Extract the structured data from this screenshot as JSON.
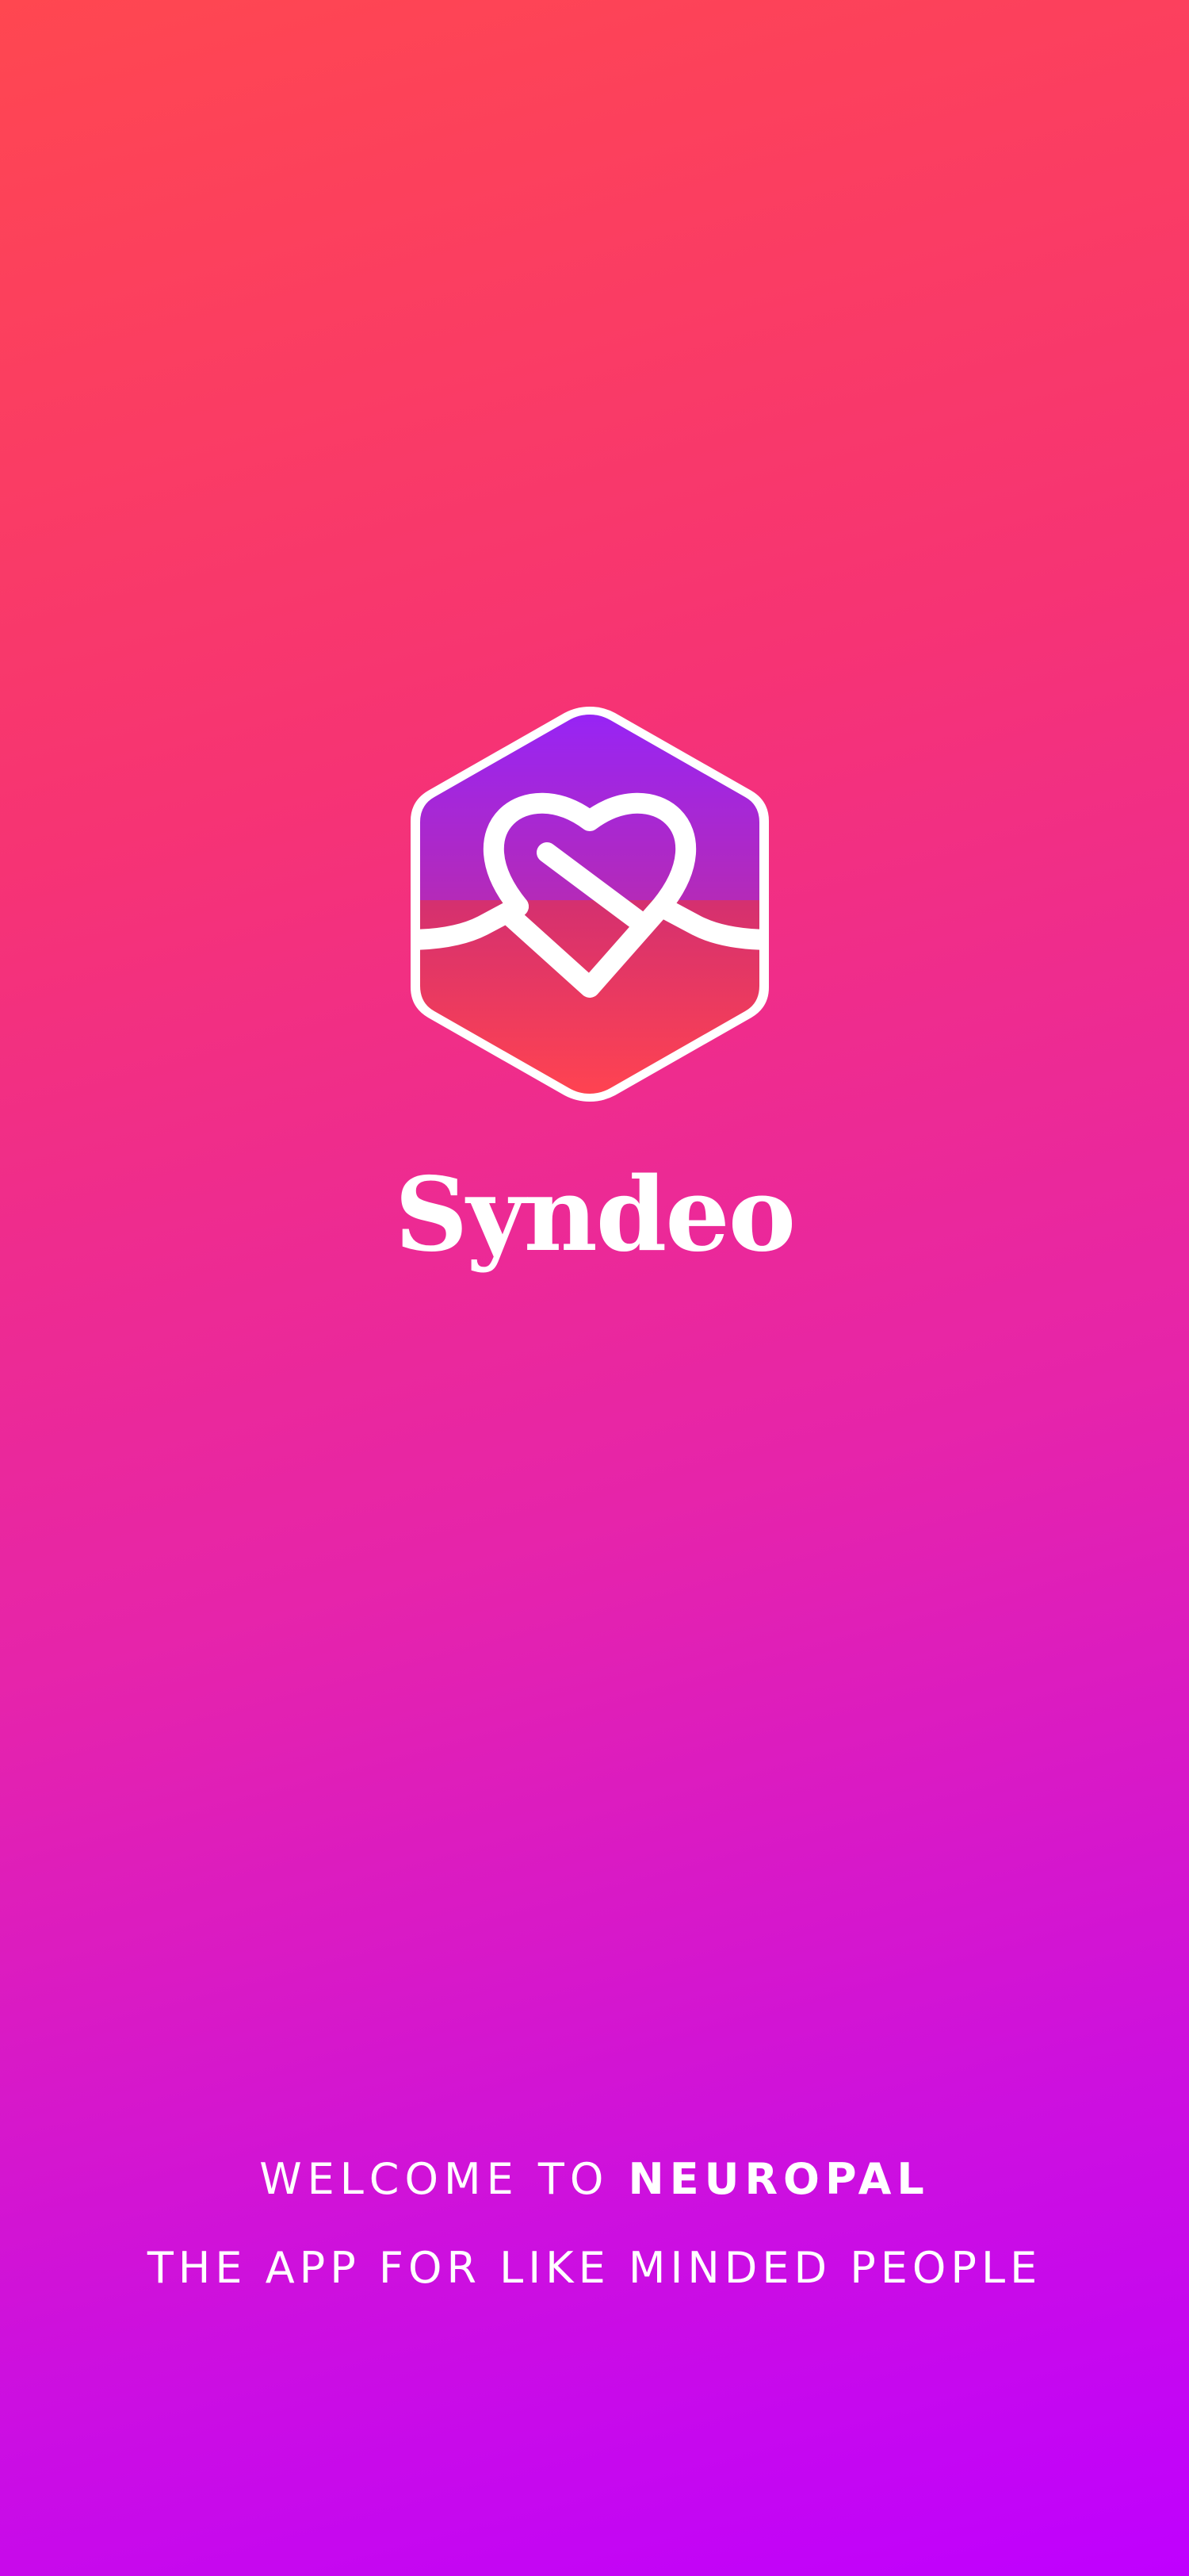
{
  "app": {
    "logo_icon": "heart-knot-hexagon-icon",
    "brand_name": "Syndeo"
  },
  "welcome": {
    "prefix": "WELCOME TO",
    "app_name": "NEUROPAL",
    "tagline": "THE APP FOR LIKE MINDED PEOPLE"
  },
  "colors": {
    "gradient_top": "#ff4750",
    "gradient_bottom": "#bf00ff",
    "logo_top": "#9b27f3",
    "logo_bottom": "#ff4351",
    "text": "#ffffff"
  }
}
